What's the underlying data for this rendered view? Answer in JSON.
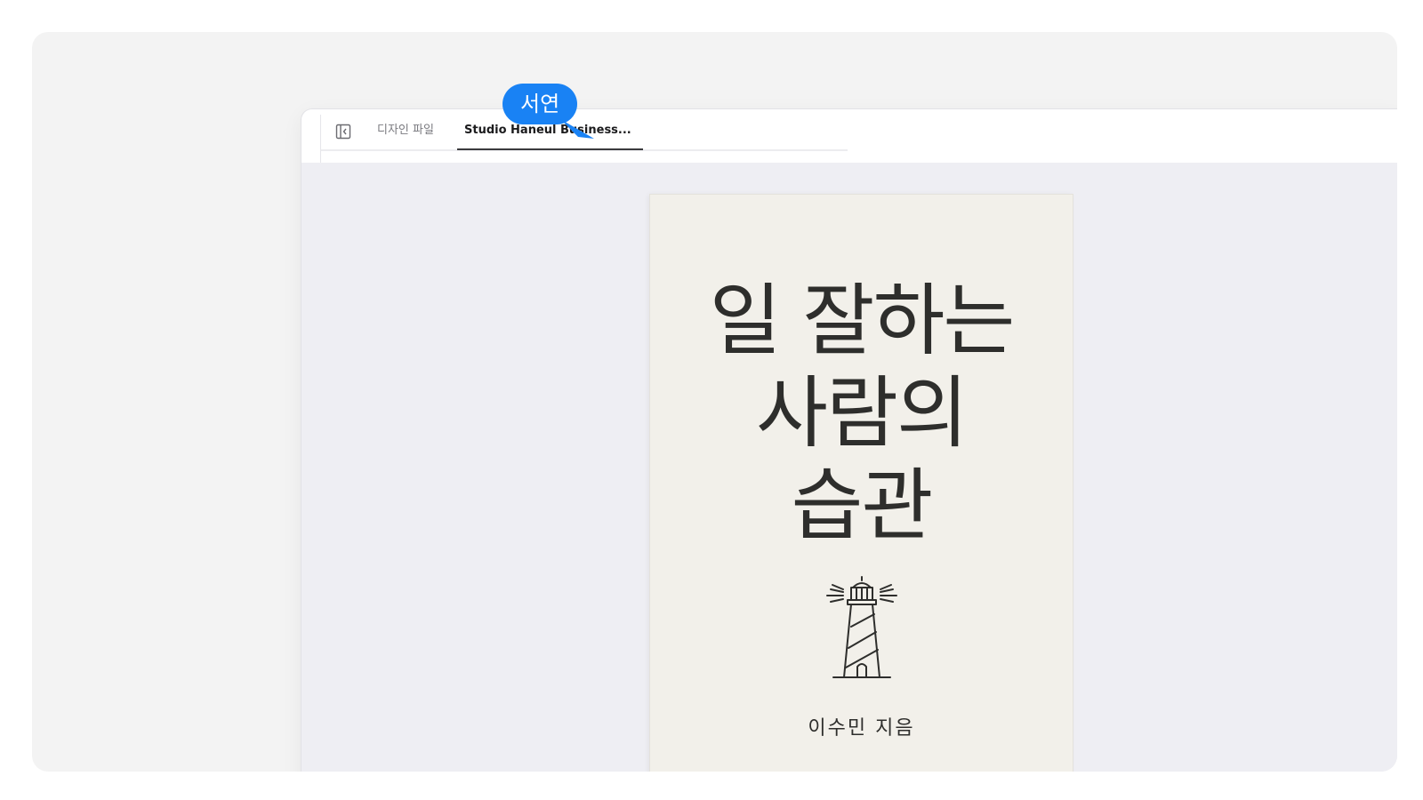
{
  "tabs": [
    {
      "label": "디자인 파일",
      "active": false
    },
    {
      "label": "Studio Haneul Business...",
      "active": true
    }
  ],
  "icons": {
    "sidebar_toggle": "sidebar-toggle-icon",
    "cover_illustration": "lighthouse-icon",
    "cursor": "pointer-cursor-icon"
  },
  "book": {
    "title_lines": [
      "일 잘하는",
      "사람의",
      "습관"
    ],
    "author": "이수민 지음"
  },
  "collaborator_cursor": {
    "name": "서연",
    "color": "#1982f4"
  }
}
